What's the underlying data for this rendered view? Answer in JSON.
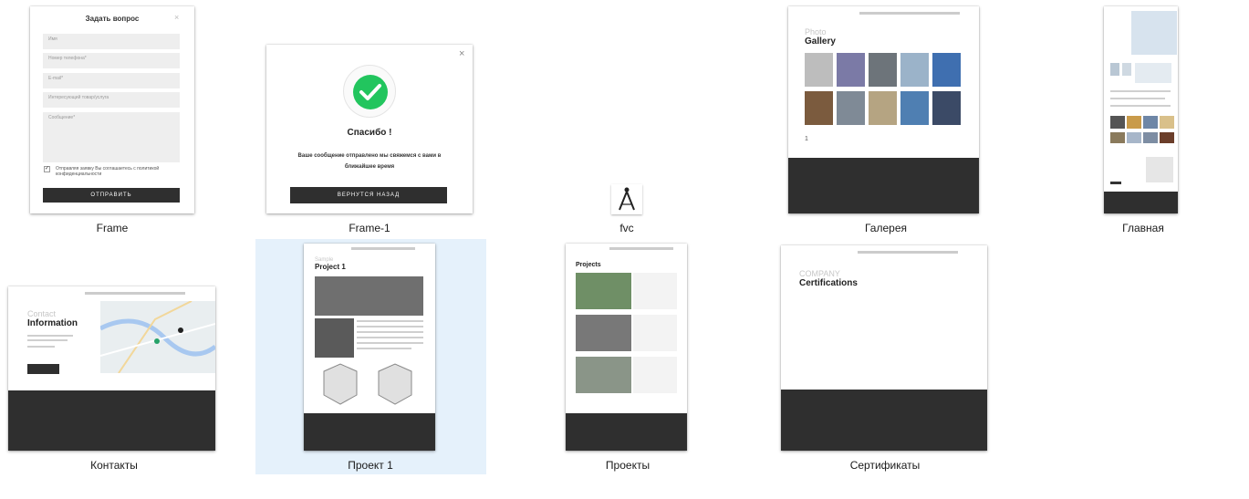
{
  "items": [
    {
      "name": "Frame"
    },
    {
      "name": "Frame-1"
    },
    {
      "name": "fvc"
    },
    {
      "name": "Галерея"
    },
    {
      "name": "Главная"
    },
    {
      "name": "Контакты"
    },
    {
      "name": "Проект 1"
    },
    {
      "name": "Проекты"
    },
    {
      "name": "Сертификаты"
    }
  ],
  "frame": {
    "title": "Задать вопрос",
    "close": "×",
    "field_name": "Имя",
    "field_phone": "Номер телефона*",
    "field_email": "E-mail*",
    "field_product": "Интересующий товар/услуга",
    "field_message": "Сообщение*",
    "consent": "Отправляя заявку Вы соглашаетесь с политикой конфиденциальности",
    "submit": "ОТПРАВИТЬ"
  },
  "frame1": {
    "close": "×",
    "title": "Спасибо !",
    "message": "Ваше сообщение отправлено мы свяжемся с вами в ближайшее время",
    "back": "ВЕРНУТСЯ НАЗАД"
  },
  "gallery": {
    "title_light": "Photo",
    "title_bold": "Gallery",
    "page": "1"
  },
  "contacts": {
    "title_light": "Contact",
    "title_bold": "Information"
  },
  "project1": {
    "title_light": "Sample",
    "title_bold": "Project 1"
  },
  "projects": {
    "title_bold": "Projects"
  },
  "certs": {
    "title_light": "COMPANY",
    "title_bold": "Certifications"
  },
  "colors": {
    "selection": "#e5f1fb",
    "dark": "#2f2f2f",
    "check": "#22c55e"
  }
}
